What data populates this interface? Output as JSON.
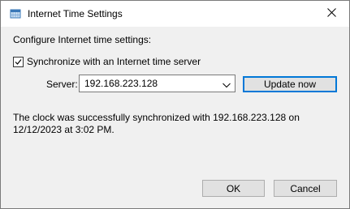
{
  "window": {
    "title": "Internet Time Settings",
    "title_icon": "clock-globe-icon",
    "close_icon": "close-icon"
  },
  "content": {
    "heading": "Configure Internet time settings:",
    "sync_checkbox": {
      "label": "Synchronize with an Internet time server",
      "checked": true
    },
    "server": {
      "label": "Server:",
      "value": "192.168.223.128"
    },
    "update_button": "Update now",
    "status_text": "The clock was successfully synchronized with 192.168.223.128 on 12/12/2023 at 3:02 PM."
  },
  "footer": {
    "ok_label": "OK",
    "cancel_label": "Cancel"
  },
  "colors": {
    "client_background": "#f0f0f0",
    "focus_border": "#0078d7",
    "button_face": "#e1e1e1"
  }
}
